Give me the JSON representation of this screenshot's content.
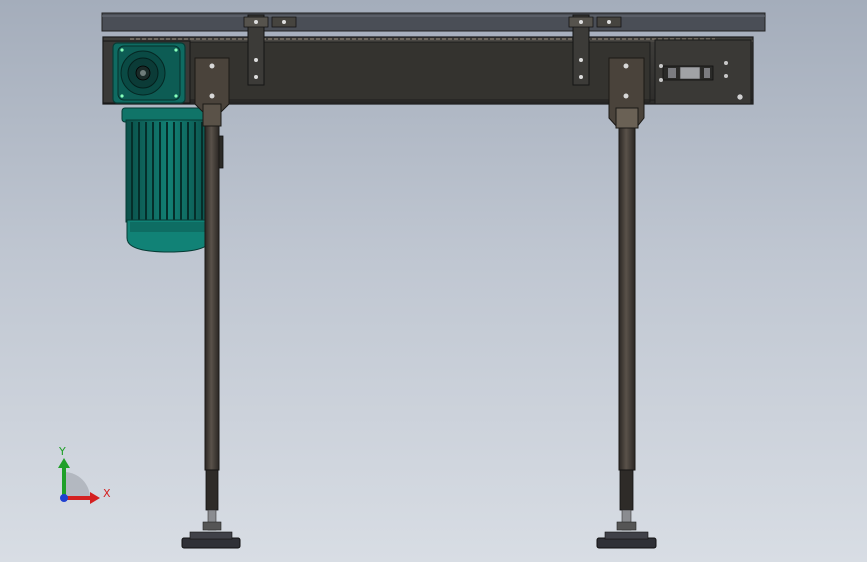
{
  "viewport": {
    "background_top": "#a4adbb",
    "background_bottom": "#d8dde4"
  },
  "model": {
    "frame_color": "#3b3a38",
    "top_rail_color": "#4a4e56",
    "motor_color": "#0f6b62",
    "leg_color": "#3d3833"
  },
  "triad": {
    "x_label": "X",
    "y_label": "Y",
    "x_color": "#d42020",
    "y_color": "#1fa028",
    "z_color": "#2040d0"
  }
}
